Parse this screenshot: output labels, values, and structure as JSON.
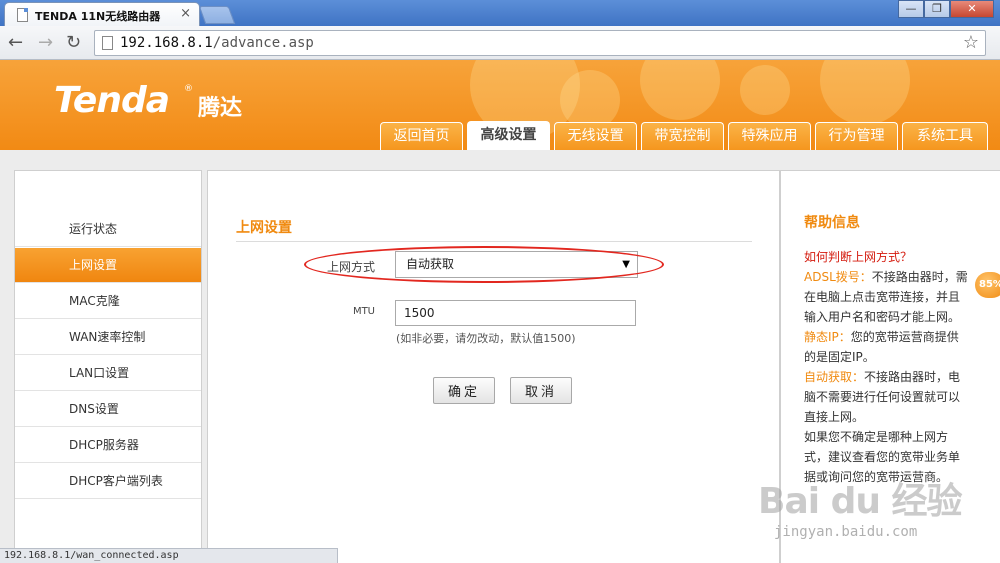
{
  "browser": {
    "tab_title": "TENDA 11N无线路由器",
    "tab_close": "×",
    "url_host": "192.168.8.1",
    "url_path": "/advance.asp",
    "minimize": "—",
    "restore": "❐",
    "close": "✕",
    "back": "←",
    "forward": "→",
    "reload": "↻",
    "star": "☆"
  },
  "header": {
    "logo": "Tenda",
    "logo_cn": "腾达",
    "reg_mark": "®",
    "tabs": [
      "返回首页",
      "高级设置",
      "无线设置",
      "带宽控制",
      "特殊应用",
      "行为管理",
      "系统工具"
    ],
    "active_tab": "高级设置"
  },
  "sidebar": {
    "items": [
      "运行状态",
      "上网设置",
      "MAC克隆",
      "WAN速率控制",
      "LAN口设置",
      "DNS设置",
      "DHCP服务器",
      "DHCP客户端列表"
    ],
    "active_item": "上网设置"
  },
  "main": {
    "section_title": "上网设置",
    "connection_label": "上网方式",
    "connection_value": "自动获取",
    "select_arrow": "▼",
    "mtu_label": "MTU",
    "mtu_value": "1500",
    "mtu_hint": "(如非必要，请勿改动，默认值1500)",
    "ok_button": "确定",
    "cancel_button": "取消"
  },
  "help": {
    "title": "帮助信息",
    "question": "如何判断上网方式？",
    "adsl_key": "ADSL拨号：",
    "adsl_text": "不接路由器时，需在电脑上点击宽带连接，并且输入用户名和密码才能上网。",
    "static_key": "静态IP：",
    "static_text": "您的宽带运营商提供的是固定IP。",
    "dhcp_key": "自动获取：",
    "dhcp_text": "不接路由器时，电脑不需要进行任何设置就可以直接上网。",
    "unsure_text": "如果您不确定是哪种上网方式，建议查看您的宽带业务单据或询问您的宽带运营商。"
  },
  "badge": "85%",
  "status_bar": "192.168.8.1/wan_connected.asp",
  "watermark": {
    "main": "Bai du 经验",
    "sub": "jingyan.baidu.com"
  },
  "colors": {
    "brand_orange": "#f28a14",
    "highlight_red": "#e2271f",
    "help_question_red": "#d41b0e"
  }
}
